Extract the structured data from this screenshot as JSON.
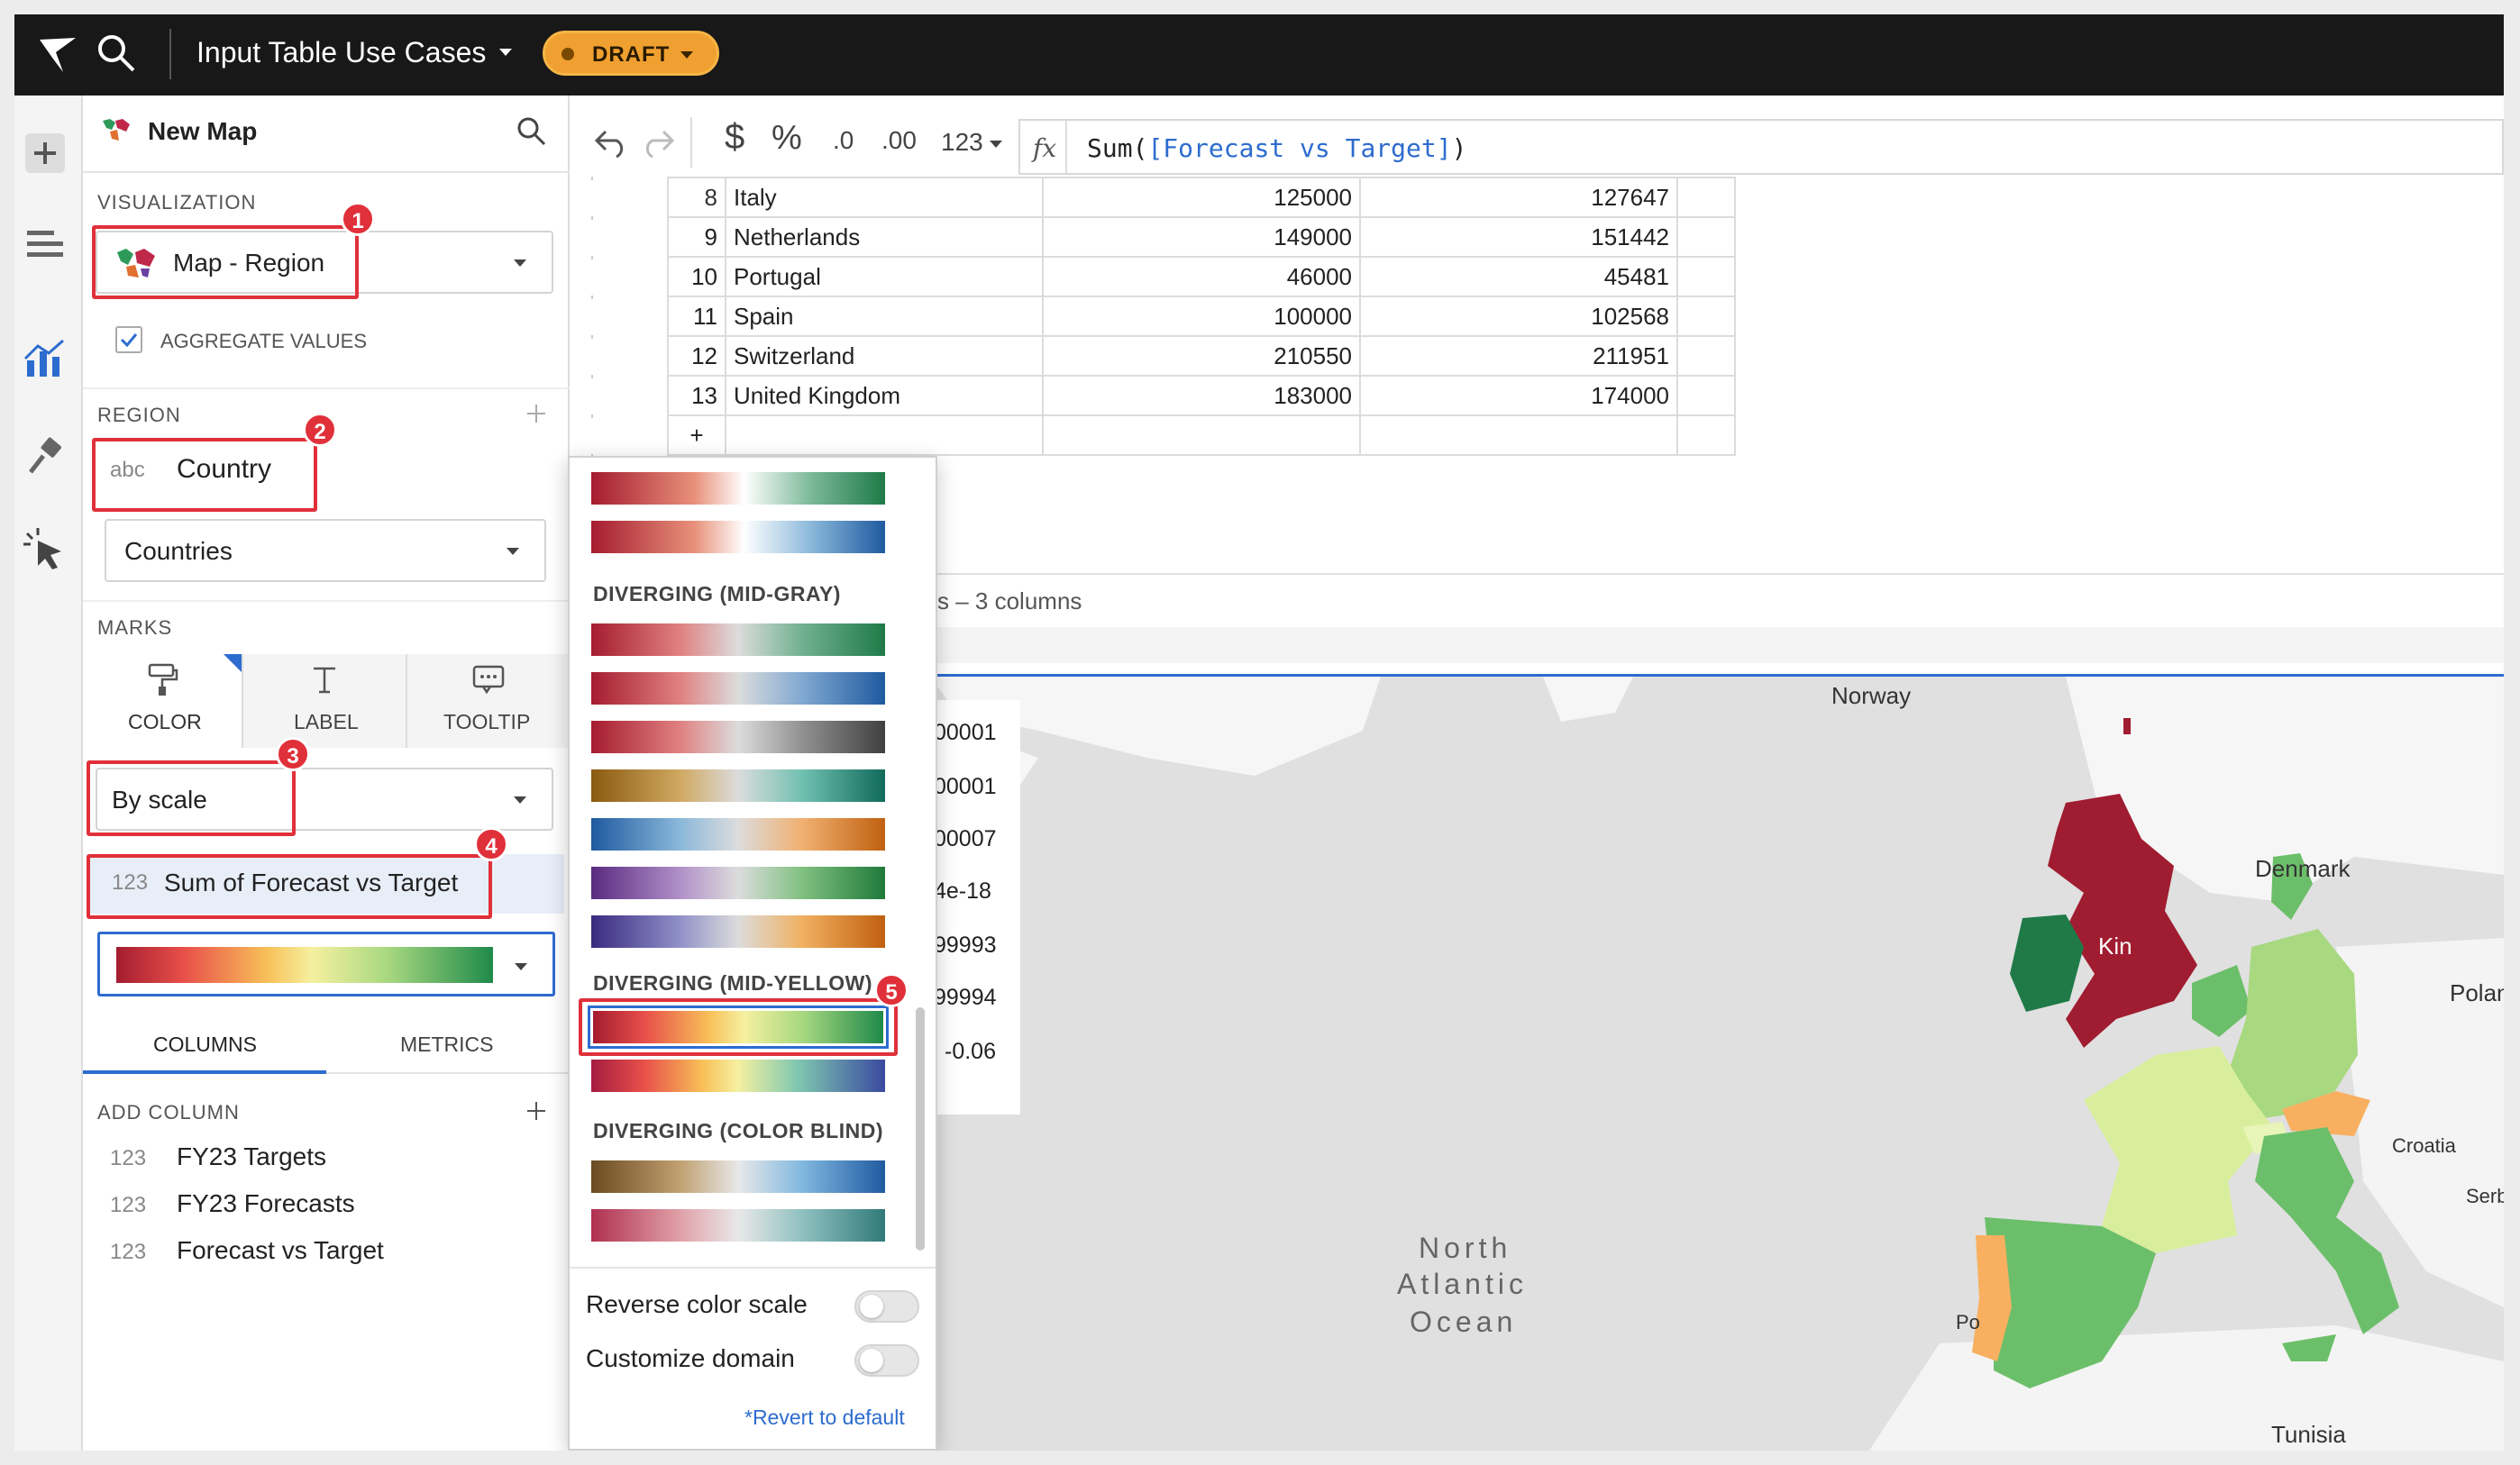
{
  "topbar": {
    "workbook_title": "Input Table Use Cases",
    "status_badge": "DRAFT"
  },
  "panel": {
    "element_title": "New Map",
    "visualization_label": "VISUALIZATION",
    "visualization_type": "Map - Region",
    "aggregate_values_label": "AGGREGATE VALUES",
    "aggregate_values_checked": true,
    "region_label": "REGION",
    "region_field_type": "abc",
    "region_field": "Country",
    "region_type": "Countries",
    "marks_label": "MARKS",
    "marks_tabs": [
      "COLOR",
      "LABEL",
      "TOOLTIP"
    ],
    "color_mode": "By scale",
    "color_field_type": "123",
    "color_field": "Sum of Forecast vs Target",
    "column_tabs": [
      "COLUMNS",
      "METRICS"
    ],
    "add_column_label": "ADD COLUMN",
    "columns": [
      {
        "type": "123",
        "name": "FY23 Targets"
      },
      {
        "type": "123",
        "name": "FY23 Forecasts"
      },
      {
        "type": "123",
        "name": "Forecast vs Target"
      }
    ]
  },
  "annotations": [
    "1",
    "2",
    "3",
    "4",
    "5"
  ],
  "toolbar": {
    "format_currency": "$",
    "format_percent": "%",
    "decimals_decrease": ".0",
    "decimals_increase": ".00",
    "number_format": "123",
    "fx_label": "fx",
    "formula_func": "Sum(",
    "formula_ref": "[Forecast vs Target]",
    "formula_close": ")"
  },
  "table": {
    "rows": [
      {
        "n": "8",
        "country": "Italy",
        "target": "125000",
        "forecast": "127647"
      },
      {
        "n": "9",
        "country": "Netherlands",
        "target": "149000",
        "forecast": "151442"
      },
      {
        "n": "10",
        "country": "Portugal",
        "target": "46000",
        "forecast": "45481"
      },
      {
        "n": "11",
        "country": "Spain",
        "target": "100000",
        "forecast": "102568"
      },
      {
        "n": "12",
        "country": "Switzerland",
        "target": "210550",
        "forecast": "211951"
      },
      {
        "n": "13",
        "country": "United Kingdom",
        "target": "183000",
        "forecast": "174000"
      }
    ],
    "add_row": "+",
    "summary_partial": "s – 3 columns"
  },
  "dropdown": {
    "group_mid_gray": "DIVERGING (MID-GRAY)",
    "group_mid_yellow": "DIVERGING (MID-YELLOW)",
    "group_color_blind": "DIVERGING (COLOR BLIND)",
    "reverse_label": "Reverse color scale",
    "reverse_on": false,
    "customize_label": "Customize domain",
    "customize_on": false,
    "revert_label": "*Revert to default"
  },
  "legend_partial": [
    "00001",
    "00001",
    "00007",
    "4e-18",
    "99993",
    "99994",
    "-0.06"
  ],
  "map_labels": {
    "norway": "Norway",
    "denmark": "Denmark",
    "poland": "Poland",
    "croatia": "Croatia",
    "serbia": "Serb",
    "tunisia": "Tunisia",
    "portugal_partial": "Po",
    "uk_partial": "Kin",
    "ocean_line1": "North",
    "ocean_line2": "Atlantic",
    "ocean_line3": "Ocean"
  },
  "colors": {
    "accent_blue": "#2d6ccf",
    "annotation_red": "#e0303a",
    "draft_orange": "#f0a030",
    "map_red": "#a01c30",
    "map_dark_green": "#1f7a48",
    "map_green": "#6cbf6a",
    "map_light_green": "#a8d880",
    "map_pale": "#d9ee9c",
    "map_orange": "#f8b060"
  }
}
